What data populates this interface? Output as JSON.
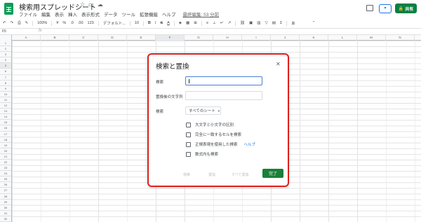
{
  "header": {
    "doc_title": "検索用スプレッドシート",
    "menu": [
      "ファイル",
      "編集",
      "表示",
      "挿入",
      "表示形式",
      "データ",
      "ツール",
      "拡張機能",
      "ヘルプ"
    ],
    "last_edit": "最終編集: 53 分前",
    "share_label": "共有",
    "brand_color": "#0b8043"
  },
  "toolbar": {
    "zoom": "100%",
    "currency": "¥",
    "percent": "%",
    "decimal_dec": ".0",
    "decimal_inc": ".00",
    "format_more": "123",
    "font": "デフォルト...",
    "font_size": "10",
    "bold": "B",
    "italic": "I",
    "strike": "S",
    "text_color": "A"
  },
  "formula_bar": {
    "cell_ref": "F5",
    "fx": "fx"
  },
  "grid": {
    "columns": [
      "A",
      "B",
      "C",
      "D",
      "E",
      "F",
      "G",
      "H",
      "I",
      "J",
      "K",
      "L",
      "M",
      "N"
    ],
    "rows": [
      "1",
      "2",
      "3",
      "4",
      "5",
      "6",
      "7",
      "8",
      "9",
      "10",
      "11",
      "12",
      "13",
      "14",
      "15",
      "16",
      "17",
      "18",
      "19",
      "20",
      "21",
      "22",
      "23",
      "24",
      "25",
      "26",
      "27",
      "28",
      "29",
      "30",
      "31",
      "32"
    ],
    "active_col": "F",
    "active_row": "5"
  },
  "dialog": {
    "title": "検索と置換",
    "find_label": "検索",
    "find_value": "",
    "replace_label": "置換後の文字列",
    "replace_value": "",
    "scope_label": "検索",
    "scope_value": "すべてのシート",
    "options": [
      {
        "label": "大文字と小文字の区別",
        "checked": false
      },
      {
        "label": "完全に一致するセルを検索",
        "checked": false
      },
      {
        "label": "正規表現を使用した検索",
        "checked": false
      },
      {
        "label": "数式内も検索",
        "checked": false
      }
    ],
    "help_link": "ヘルプ",
    "find_button": "検索",
    "replace_button": "置換",
    "replace_all_button": "すべて置換",
    "done_button": "完了",
    "highlight_color": "#e0201c"
  }
}
